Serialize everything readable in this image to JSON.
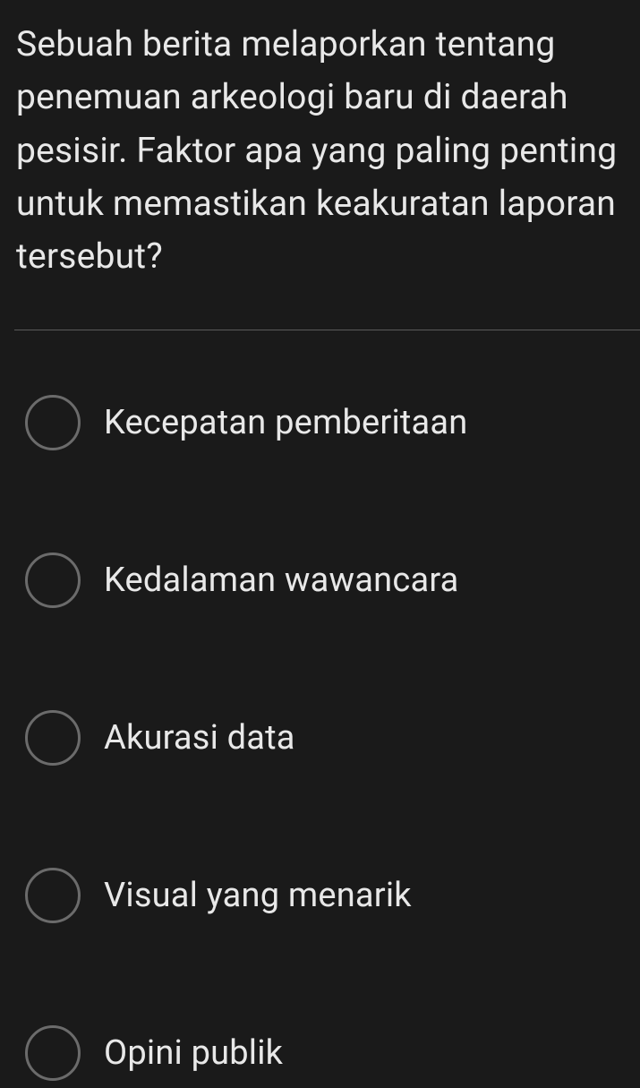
{
  "question": "Sebuah berita melaporkan tentang penemuan arkeologi baru di daerah pesisir. Faktor apa yang paling penting untuk memastikan keakuratan laporan tersebut?",
  "options": [
    {
      "label": "Kecepatan pemberitaan"
    },
    {
      "label": "Kedalaman wawancara"
    },
    {
      "label": "Akurasi data"
    },
    {
      "label": "Visual yang menarik"
    },
    {
      "label": "Opini publik"
    }
  ]
}
